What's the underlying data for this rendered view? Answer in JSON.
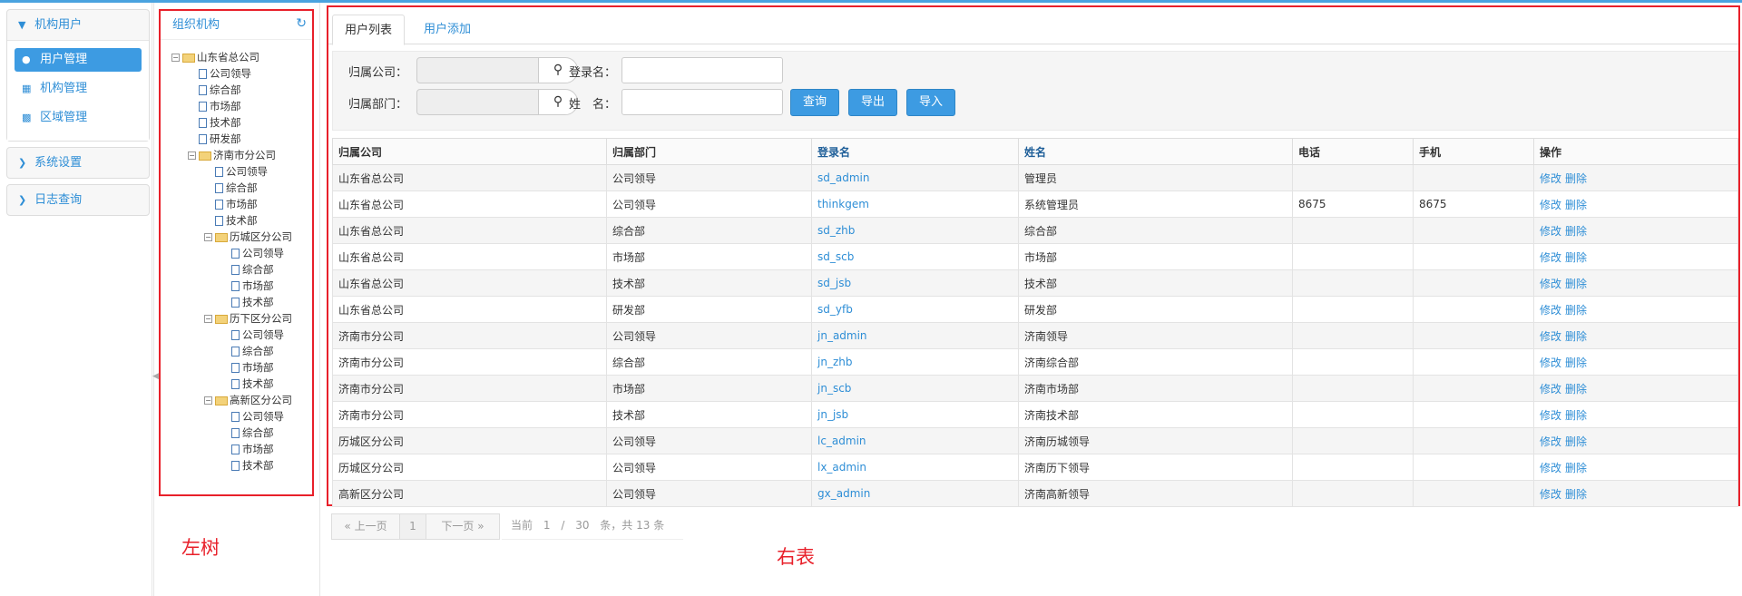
{
  "nav": {
    "group1": {
      "title": "机构用户",
      "items": [
        {
          "label": "用户管理",
          "icon": "user-icon",
          "active": true
        },
        {
          "label": "机构管理",
          "icon": "grid-icon",
          "active": false
        },
        {
          "label": "区域管理",
          "icon": "grid-small-icon",
          "active": false
        }
      ]
    },
    "group2": {
      "title": "系统设置"
    },
    "group3": {
      "title": "日志查询"
    }
  },
  "tree": {
    "title": "组织机构",
    "nodes": [
      {
        "level": 0,
        "type": "folder",
        "label": "山东省总公司"
      },
      {
        "level": 1,
        "type": "leaf",
        "label": "公司领导"
      },
      {
        "level": 1,
        "type": "leaf",
        "label": "综合部"
      },
      {
        "level": 1,
        "type": "leaf",
        "label": "市场部"
      },
      {
        "level": 1,
        "type": "leaf",
        "label": "技术部"
      },
      {
        "level": 1,
        "type": "leaf",
        "label": "研发部"
      },
      {
        "level": 1,
        "type": "folder",
        "label": "济南市分公司"
      },
      {
        "level": 2,
        "type": "leaf",
        "label": "公司领导"
      },
      {
        "level": 2,
        "type": "leaf",
        "label": "综合部"
      },
      {
        "level": 2,
        "type": "leaf",
        "label": "市场部"
      },
      {
        "level": 2,
        "type": "leaf",
        "label": "技术部"
      },
      {
        "level": 2,
        "type": "folder",
        "label": "历城区分公司"
      },
      {
        "level": 3,
        "type": "leaf",
        "label": "公司领导"
      },
      {
        "level": 3,
        "type": "leaf",
        "label": "综合部"
      },
      {
        "level": 3,
        "type": "leaf",
        "label": "市场部"
      },
      {
        "level": 3,
        "type": "leaf",
        "label": "技术部"
      },
      {
        "level": 2,
        "type": "folder",
        "label": "历下区分公司"
      },
      {
        "level": 3,
        "type": "leaf",
        "label": "公司领导"
      },
      {
        "level": 3,
        "type": "leaf",
        "label": "综合部"
      },
      {
        "level": 3,
        "type": "leaf",
        "label": "市场部"
      },
      {
        "level": 3,
        "type": "leaf",
        "label": "技术部"
      },
      {
        "level": 2,
        "type": "folder",
        "label": "高新区分公司"
      },
      {
        "level": 3,
        "type": "leaf",
        "label": "公司领导"
      },
      {
        "level": 3,
        "type": "leaf",
        "label": "综合部"
      },
      {
        "level": 3,
        "type": "leaf",
        "label": "市场部"
      },
      {
        "level": 3,
        "type": "leaf",
        "label": "技术部"
      }
    ]
  },
  "annotations": {
    "left": "左树",
    "right": "右表"
  },
  "tabs": {
    "list": "用户列表",
    "add": "用户添加"
  },
  "search": {
    "company_label": "归属公司：",
    "company_value": "",
    "dept_label": "归属部门：",
    "dept_value": "",
    "login_label": "登录名：",
    "login_value": "",
    "name_label": "姓　名：",
    "name_value": "",
    "query_button": "查询",
    "export_button": "导出",
    "import_button": "导入"
  },
  "table": {
    "headers": [
      "归属公司",
      "归属部门",
      "登录名",
      "姓名",
      "电话",
      "手机",
      "操作"
    ],
    "edit_label": "修改",
    "delete_label": "删除",
    "rows": [
      {
        "company": "山东省总公司",
        "dept": "公司领导",
        "login": "sd_admin",
        "name": "管理员",
        "phone": "",
        "mobile": ""
      },
      {
        "company": "山东省总公司",
        "dept": "公司领导",
        "login": "thinkgem",
        "name": "系统管理员",
        "phone": "8675",
        "mobile": "8675"
      },
      {
        "company": "山东省总公司",
        "dept": "综合部",
        "login": "sd_zhb",
        "name": "综合部",
        "phone": "",
        "mobile": ""
      },
      {
        "company": "山东省总公司",
        "dept": "市场部",
        "login": "sd_scb",
        "name": "市场部",
        "phone": "",
        "mobile": ""
      },
      {
        "company": "山东省总公司",
        "dept": "技术部",
        "login": "sd_jsb",
        "name": "技术部",
        "phone": "",
        "mobile": ""
      },
      {
        "company": "山东省总公司",
        "dept": "研发部",
        "login": "sd_yfb",
        "name": "研发部",
        "phone": "",
        "mobile": ""
      },
      {
        "company": "济南市分公司",
        "dept": "公司领导",
        "login": "jn_admin",
        "name": "济南领导",
        "phone": "",
        "mobile": ""
      },
      {
        "company": "济南市分公司",
        "dept": "综合部",
        "login": "jn_zhb",
        "name": "济南综合部",
        "phone": "",
        "mobile": ""
      },
      {
        "company": "济南市分公司",
        "dept": "市场部",
        "login": "jn_scb",
        "name": "济南市场部",
        "phone": "",
        "mobile": ""
      },
      {
        "company": "济南市分公司",
        "dept": "技术部",
        "login": "jn_jsb",
        "name": "济南技术部",
        "phone": "",
        "mobile": ""
      },
      {
        "company": "历城区分公司",
        "dept": "公司领导",
        "login": "lc_admin",
        "name": "济南历城领导",
        "phone": "",
        "mobile": ""
      },
      {
        "company": "历城区分公司",
        "dept": "公司领导",
        "login": "lx_admin",
        "name": "济南历下领导",
        "phone": "",
        "mobile": ""
      },
      {
        "company": "高新区分公司",
        "dept": "公司领导",
        "login": "gx_admin",
        "name": "济南高新领导",
        "phone": "",
        "mobile": ""
      }
    ]
  },
  "pager": {
    "prev": "« 上一页",
    "current": "1",
    "next": "下一页 »",
    "info_prefix": "当前",
    "page_input": "1",
    "slash": "/",
    "page_size": "30",
    "info_suffix": "条，共 13 条"
  }
}
